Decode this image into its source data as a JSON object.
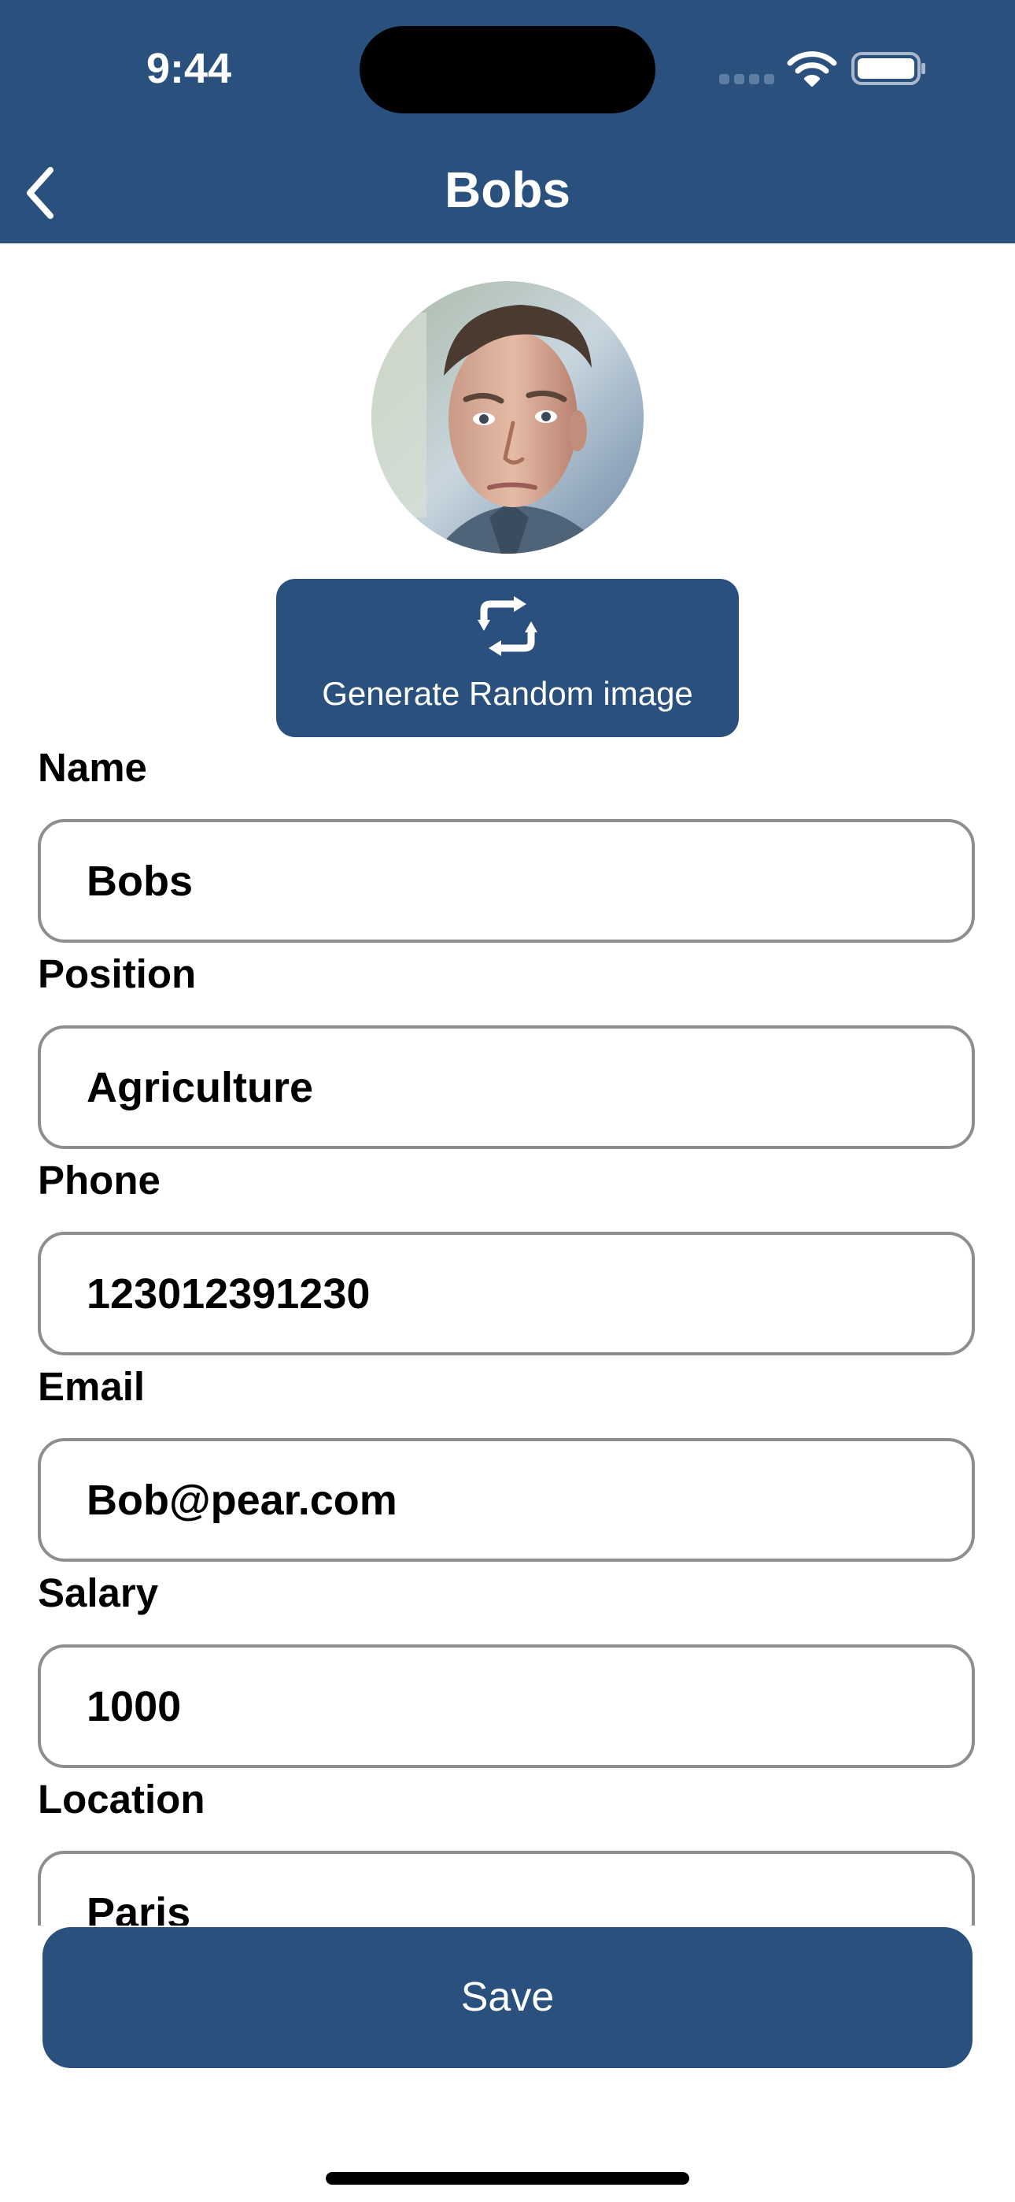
{
  "status_bar": {
    "time": "9:44"
  },
  "nav": {
    "title": "Bobs",
    "back_icon": "chevron-left-icon"
  },
  "profile": {
    "generate_label": "Generate Random image",
    "generate_icon": "refresh-icon"
  },
  "fields": {
    "name": {
      "label": "Name",
      "value": "Bobs"
    },
    "position": {
      "label": "Position",
      "value": "Agriculture"
    },
    "phone": {
      "label": "Phone",
      "value": "123012391230"
    },
    "email": {
      "label": "Email",
      "value": "Bob@pear.com"
    },
    "salary": {
      "label": "Salary",
      "value": "1000"
    },
    "location": {
      "label": "Location",
      "value": "Paris"
    }
  },
  "actions": {
    "save_label": "Save"
  },
  "colors": {
    "primary": "#2a517d",
    "input_border": "#8e8e8e",
    "background": "#ffffff"
  }
}
